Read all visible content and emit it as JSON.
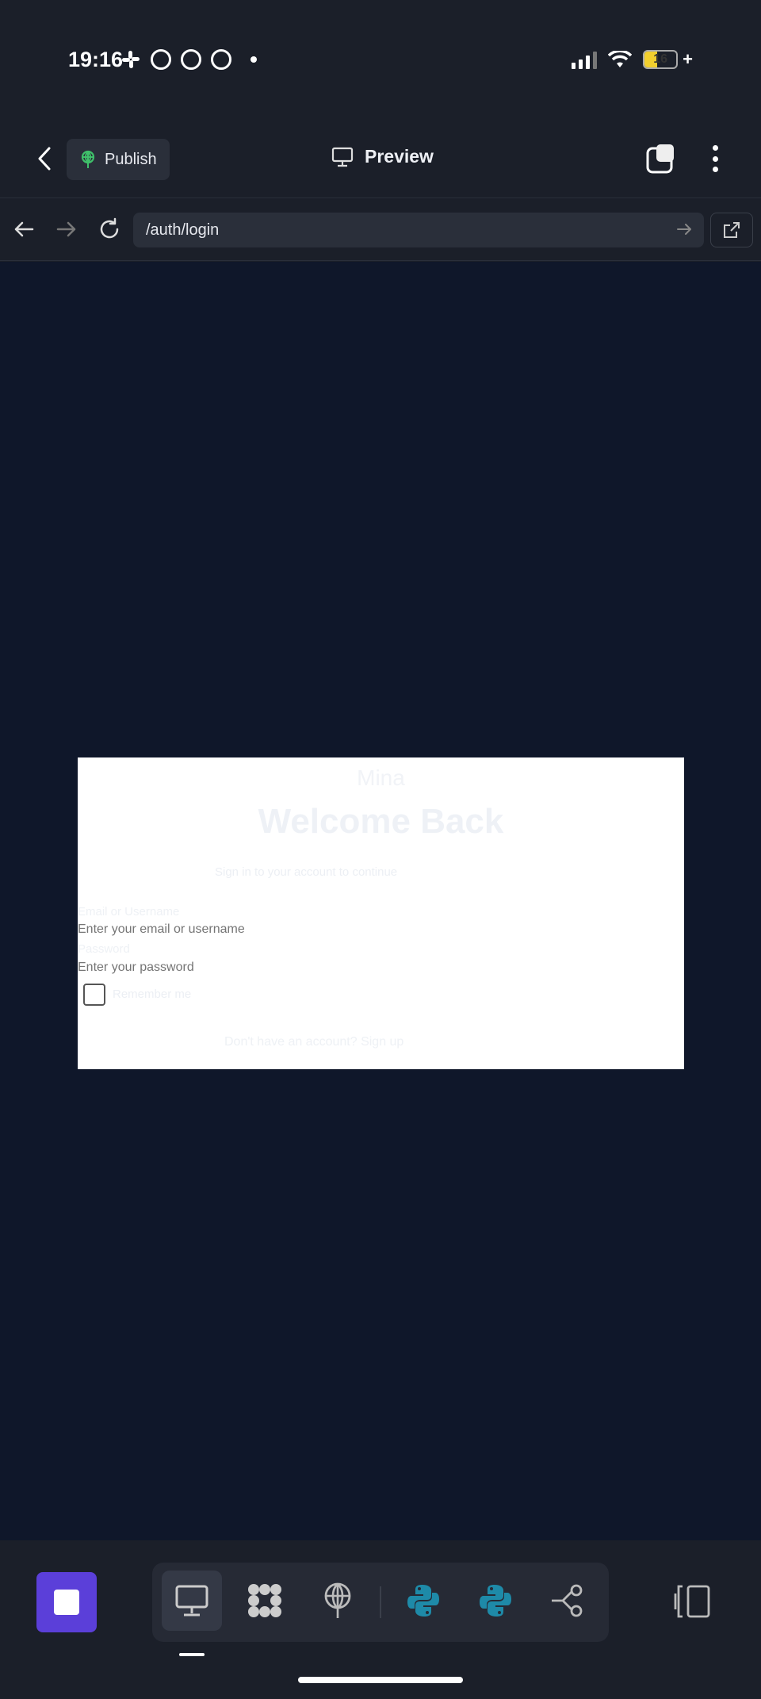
{
  "status_bar": {
    "time": "19:16",
    "battery": "16",
    "battery_plus": "+"
  },
  "top_bar": {
    "publish_label": "Publish",
    "preview_label": "Preview"
  },
  "url_bar": {
    "url": "/auth/login"
  },
  "login": {
    "brand": "Mina",
    "title": "Welcome Back",
    "subtitle": "Sign in to your account to continue",
    "email_label": "Email or Username",
    "email_placeholder": "Enter your email or username",
    "password_label": "Password",
    "password_placeholder": "Enter your password",
    "remember_label": "Remember me",
    "signup_text": "Don't have an account? Sign up"
  },
  "colors": {
    "background": "#1b1f29",
    "preview_background": "#0f172a",
    "accent": "#5b3fd9",
    "python": "#1e8aa8"
  },
  "toolbar": {
    "icons": [
      "desktop-icon",
      "apps-icon",
      "deploy-icon",
      "python-icon",
      "python-icon",
      "workflow-icon",
      "panel-icon"
    ]
  }
}
